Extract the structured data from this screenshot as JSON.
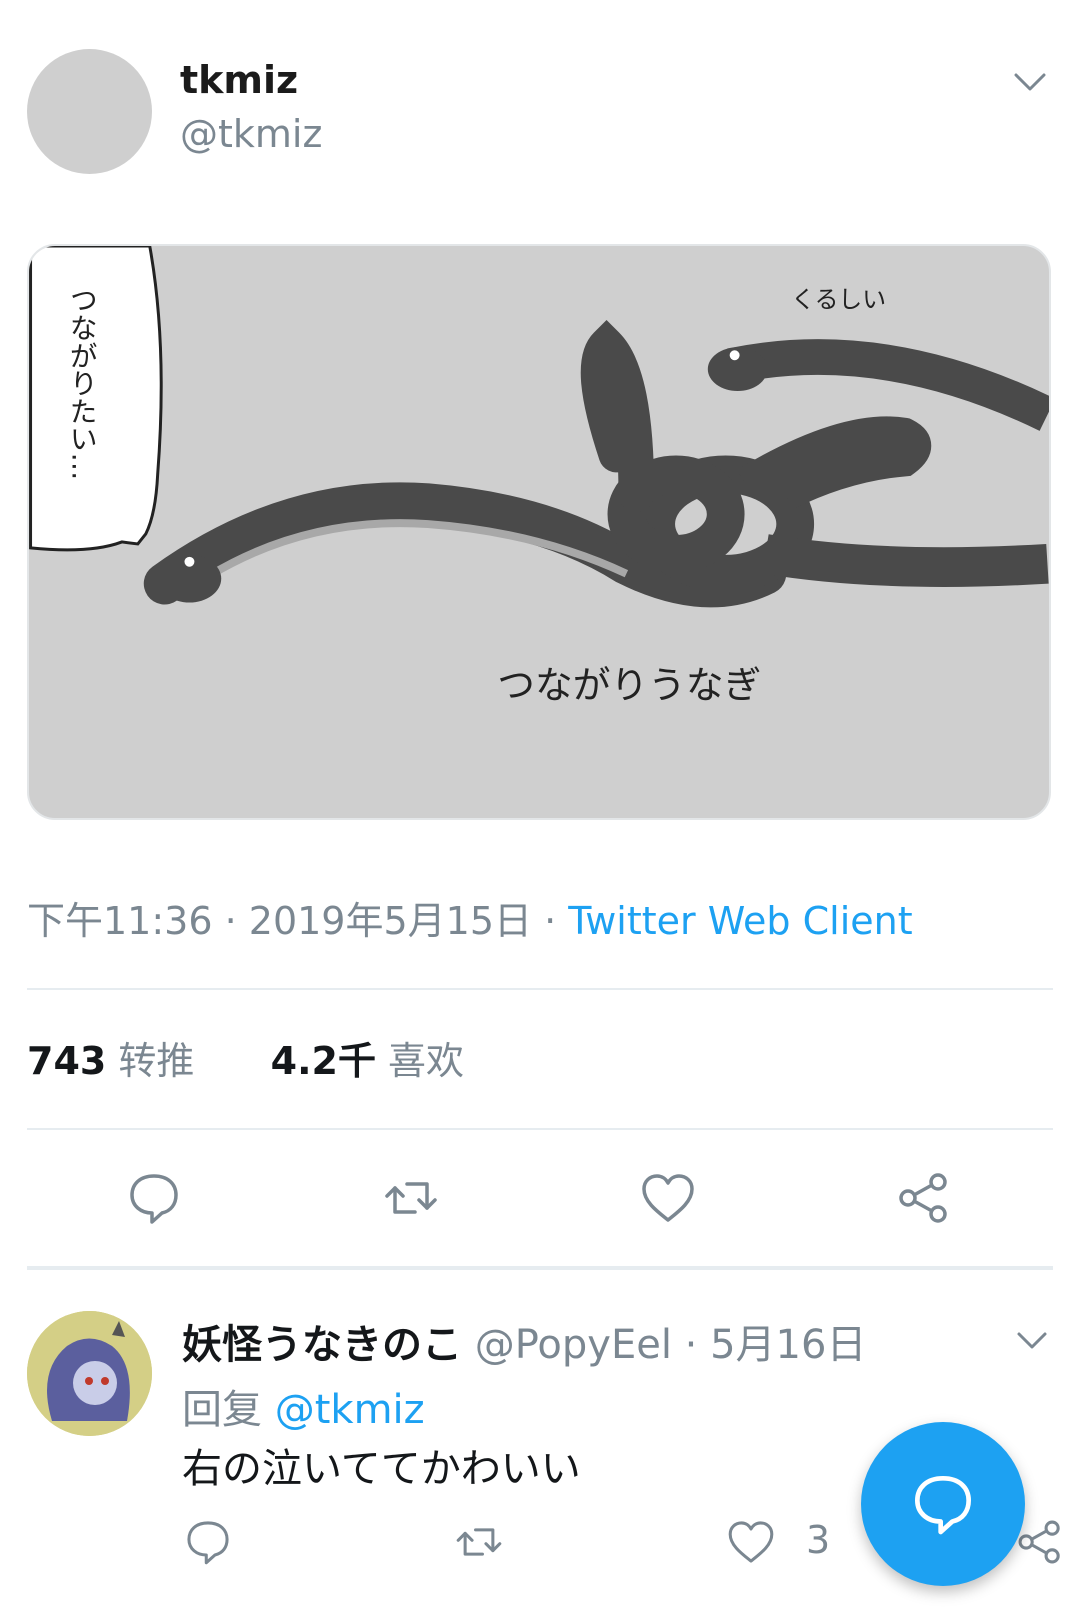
{
  "tweet": {
    "author_name": "tkmiz",
    "author_handle": "@tkmiz",
    "media": {
      "speech_bubble": "つながりたい…",
      "small_caption": "くるしい",
      "caption": "つながりうなぎ"
    },
    "time": "下午11:36",
    "sep": " · ",
    "date": "2019年5月15日",
    "source": "Twitter Web Client",
    "retweet_count": "743",
    "retweet_label": "转推",
    "like_count": "4.2千",
    "like_label": "喜欢"
  },
  "reply": {
    "author_name": "妖怪うなきのこ",
    "author_handle": "@PopyEel",
    "sep": " · ",
    "date": "5月16日",
    "reply_prefix": "回复",
    "reply_mention": "@tkmiz",
    "text": "右の泣いててかわいい",
    "like_count": "3"
  },
  "colors": {
    "accent": "#1da1f2",
    "muted": "#7b8791",
    "media_background": "#cfcfcf",
    "eel": "#4a4a4a"
  },
  "icons": {
    "menu": "chevron-down-icon",
    "reply": "comment-bubble-icon",
    "retweet": "retweet-icon",
    "like": "heart-icon",
    "share": "share-icon",
    "compose": "compose-reply-icon"
  }
}
